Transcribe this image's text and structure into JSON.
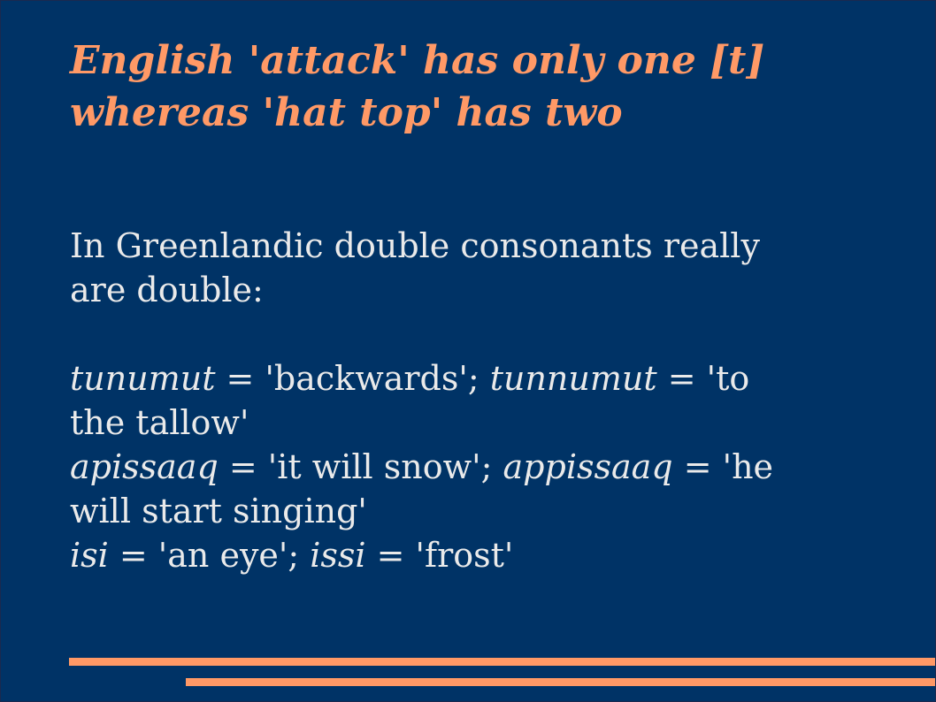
{
  "title": {
    "line1": "English 'attack' has only one [t]",
    "line2": "whereas 'hat top' has two"
  },
  "intro": {
    "line1": "In Greenlandic double consonants really",
    "line2": "are double:"
  },
  "examples": [
    {
      "word1": "tunumut",
      "gloss1": " = 'backwards'; ",
      "word2": "tunnumut",
      "gloss2_part1": " = 'to",
      "gloss2_part2": "the tallow'"
    },
    {
      "word1": "apissaaq",
      "gloss1": " = 'it will snow'; ",
      "word2": "appissaaq",
      "gloss2_part1": " = 'he",
      "gloss2_part2": "will start singing'"
    },
    {
      "word1": "isi",
      "gloss1": " = 'an eye'; ",
      "word2": "issi",
      "gloss2_part1": " = 'frost'"
    }
  ],
  "colors": {
    "background": "#003366",
    "title": "#ff9966",
    "body_text": "#eaeaea",
    "accent_rules": "#ff9966"
  }
}
